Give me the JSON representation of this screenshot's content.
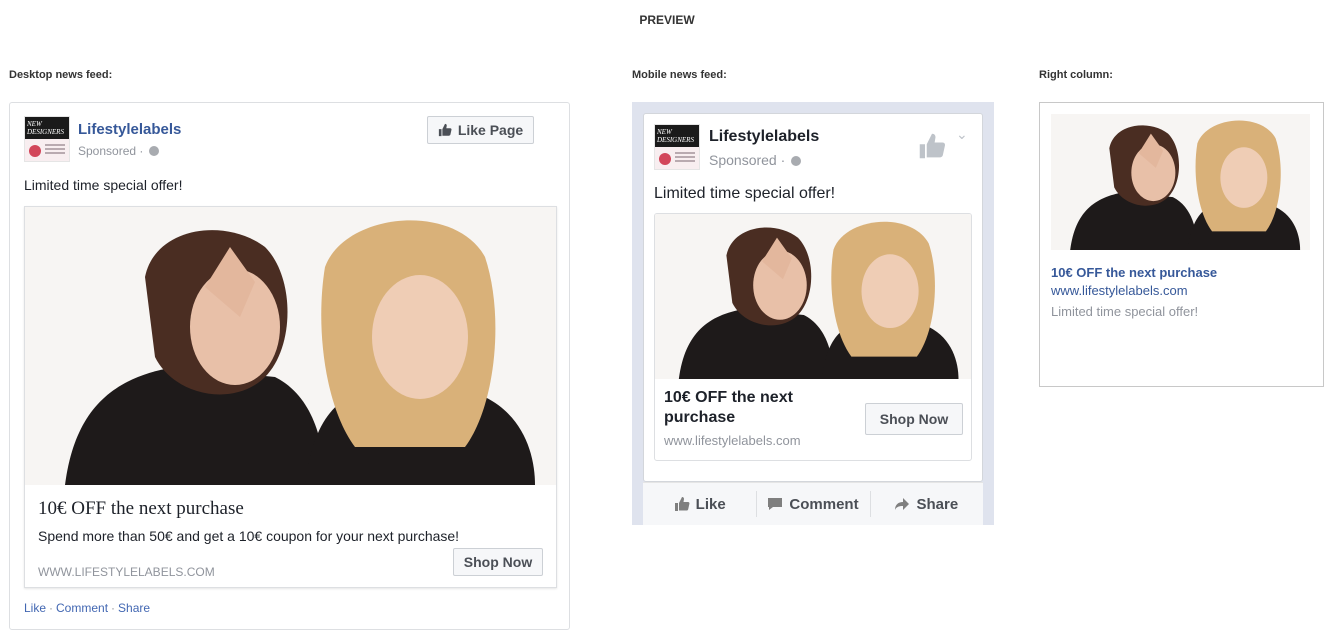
{
  "preview_title": "PREVIEW",
  "columns": {
    "desktop_label": "Desktop news feed:",
    "mobile_label": "Mobile news feed:",
    "right_label": "Right column:"
  },
  "logo": {
    "text": "NEW DESIGNERS",
    "tagline": "Click below to get decided to vote our Lovers clicks"
  },
  "desktop": {
    "page_name": "Lifestylelabels",
    "sponsored": "Sponsored",
    "like_page_label": "Like Page",
    "message": "Limited time special offer!",
    "headline": "10€ OFF the next purchase",
    "description": "Spend more than 50€ and get a 10€ coupon for your next purchase!",
    "url": "WWW.LIFESTYLELABELS.COM",
    "cta": "Shop Now",
    "actions": [
      "Like",
      "Comment",
      "Share"
    ]
  },
  "mobile": {
    "page_name": "Lifestylelabels",
    "sponsored": "Sponsored",
    "message": "Limited time special offer!",
    "headline": "10€ OFF the next purchase",
    "url": "www.lifestylelabels.com",
    "cta": "Shop Now",
    "actions": [
      "Like",
      "Comment",
      "Share"
    ]
  },
  "right": {
    "headline": "10€ OFF the next purchase",
    "url": "www.lifestylelabels.com",
    "description": "Limited time special offer!"
  },
  "colors": {
    "link_blue": "#365899",
    "action_blue": "#4267b2",
    "gray_text": "#90949c",
    "mobile_bg": "#dfe3ee"
  }
}
